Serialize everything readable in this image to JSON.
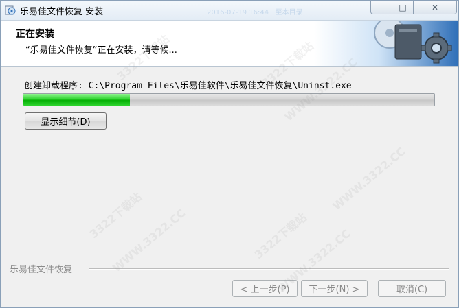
{
  "window": {
    "title": "乐易佳文件恢复 安装",
    "title_ghost": "2016-07-19 16:44   至本目录",
    "controls": {
      "minimize": "—",
      "maximize": "□",
      "close": "✕"
    }
  },
  "header": {
    "title": "正在安装",
    "subtitle": "“乐易佳文件恢复”正在安装，请等候..."
  },
  "content": {
    "status": "创建卸载程序: C:\\Program Files\\乐易佳软件\\乐易佳文件恢复\\Uninst.exe",
    "progress_fraction": 0.26,
    "details_button": "显示细节(D)"
  },
  "footer": {
    "brand": "乐易佳文件恢复",
    "back_button": "< 上一步(P)",
    "next_button": "下一步(N) >",
    "cancel_button": "取消(C)"
  },
  "watermarks": [
    "3322下载站",
    "WWW.3322.CC",
    "3322下载站",
    "WWW.3322.CC",
    "3322下载站",
    "WWW.3322.CC",
    "3322下载站",
    "WWW.3322.CC"
  ],
  "colors": {
    "progress": "#06b006",
    "accent": "#2f6fb8",
    "disabled_text": "#8a8a8a"
  },
  "icons": [
    "installer-app-icon",
    "minimize-icon",
    "maximize-icon",
    "close-icon",
    "disc-gear-header-icon"
  ]
}
